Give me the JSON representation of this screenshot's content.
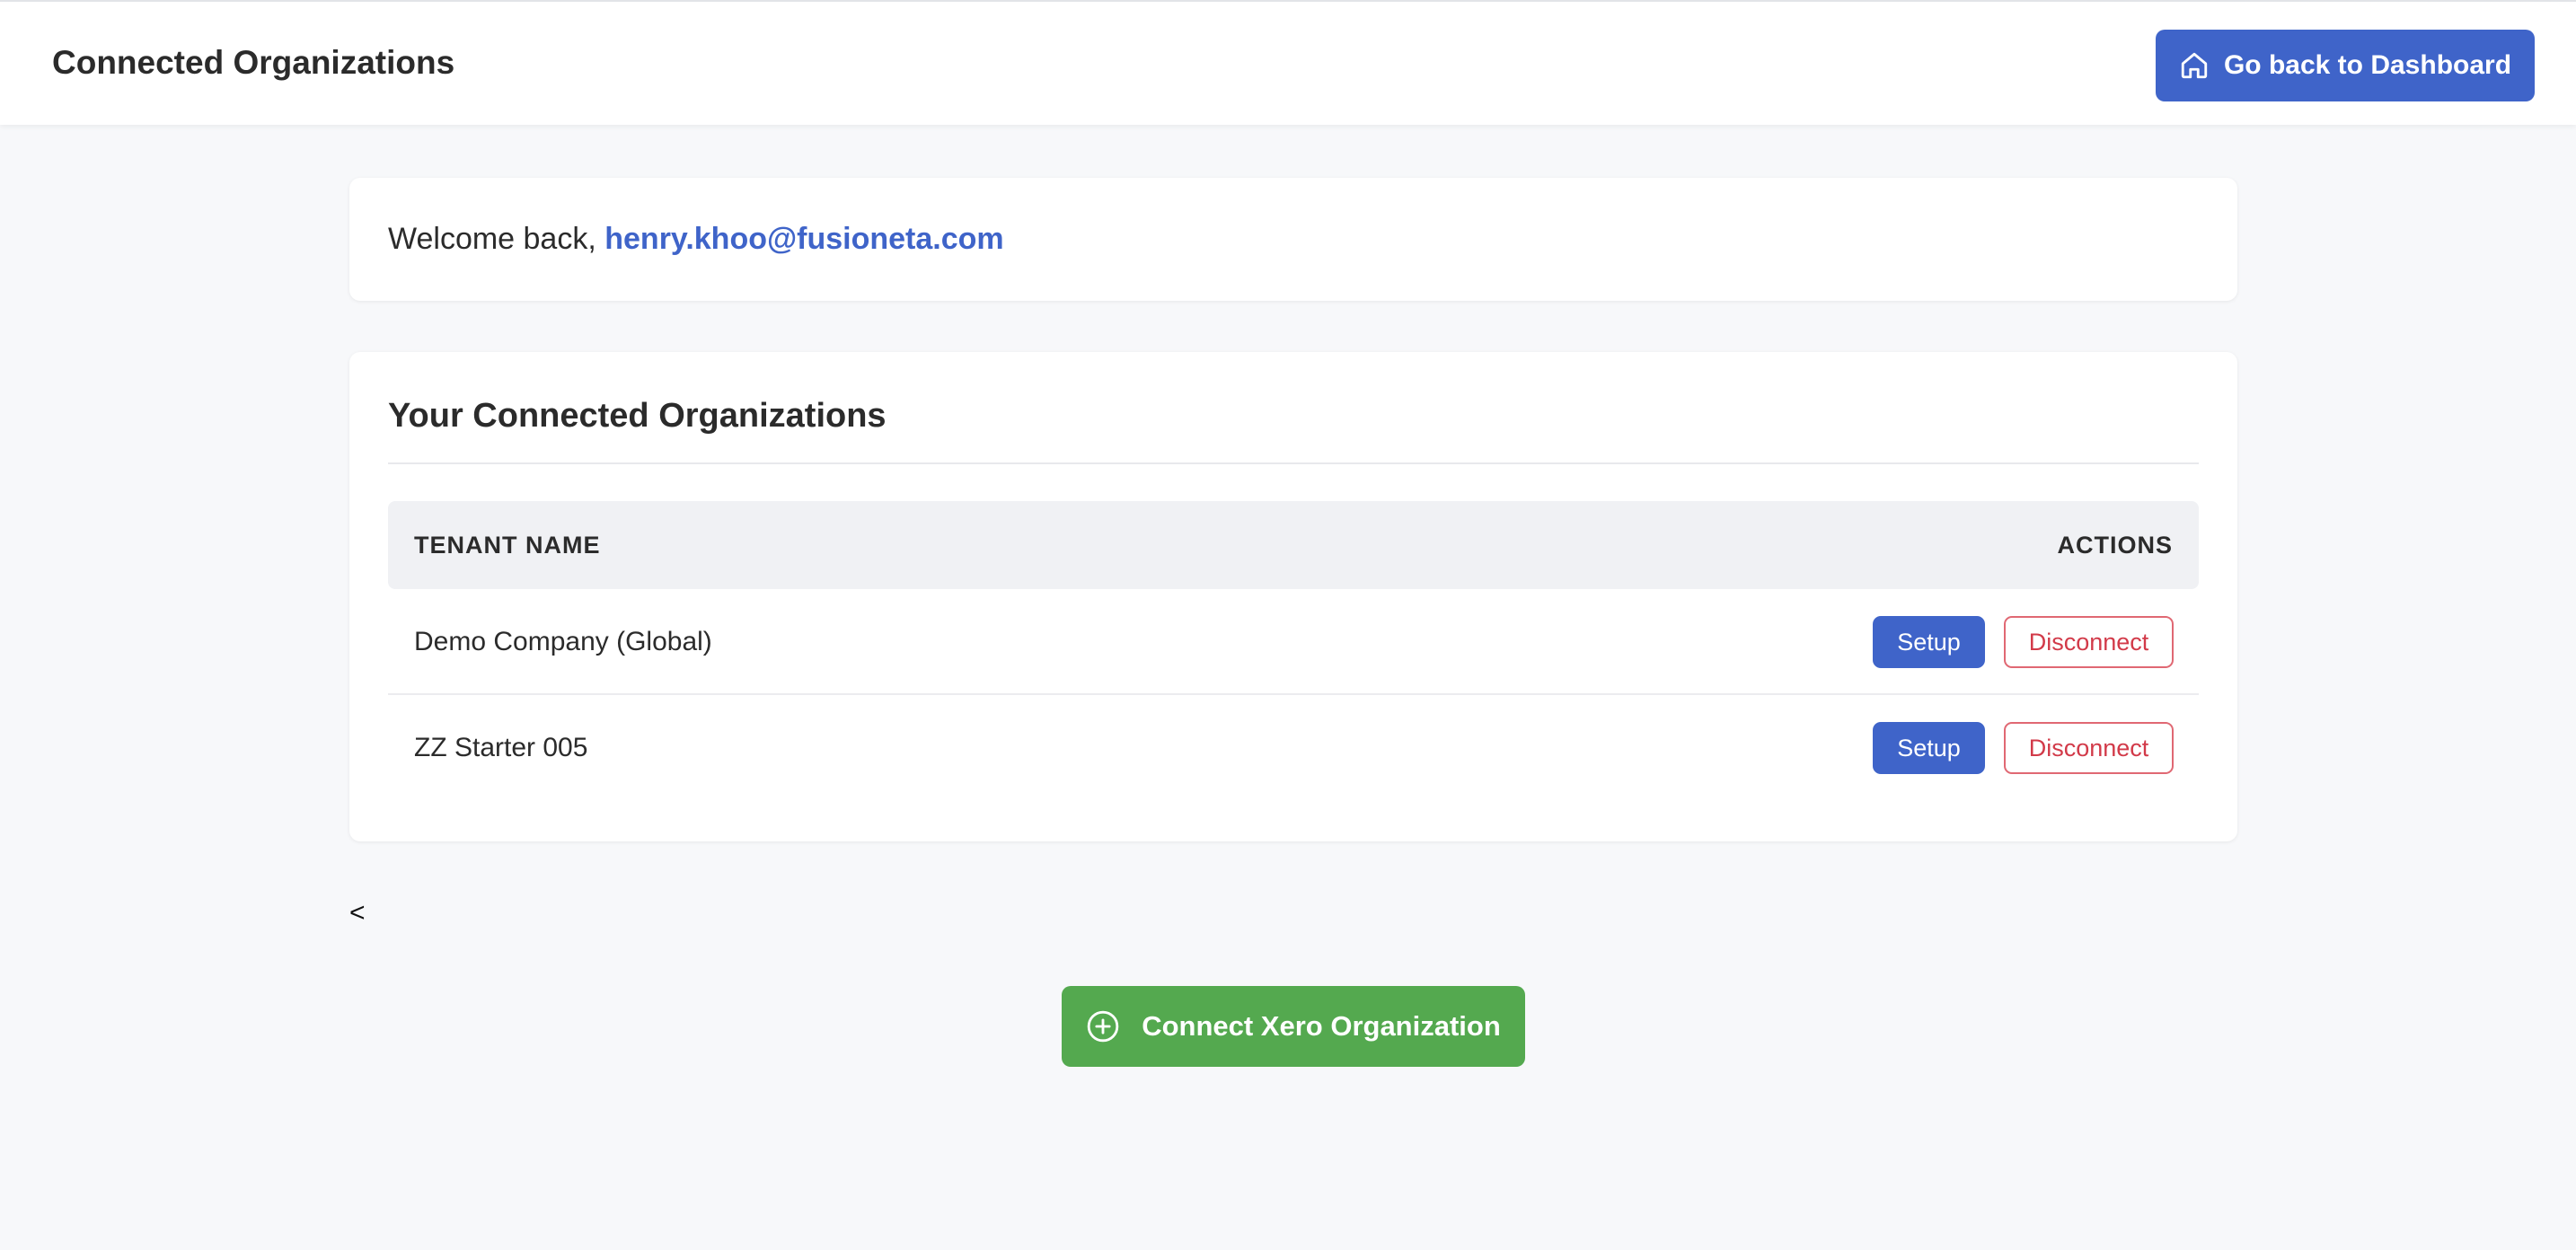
{
  "header": {
    "title": "Connected Organizations",
    "dashboard_button_label": "Go back to Dashboard",
    "dashboard_button_icon": "home-icon"
  },
  "welcome": {
    "prefix": "Welcome back, ",
    "email": "henry.khoo@fusioneta.com"
  },
  "organizations": {
    "section_title": "Your Connected Organizations",
    "columns": [
      "TENANT NAME",
      "ACTIONS"
    ],
    "rows": [
      {
        "tenant_name": "Demo Company (Global)",
        "setup_label": "Setup",
        "disconnect_label": "Disconnect"
      },
      {
        "tenant_name": "ZZ Starter 005",
        "setup_label": "Setup",
        "disconnect_label": "Disconnect"
      }
    ]
  },
  "back_link": "<",
  "connect_button": {
    "label": "Connect Xero Organization",
    "icon": "plus-circle-icon"
  },
  "colors": {
    "primary": "#3f64c9",
    "success": "#54a94f",
    "danger": "#d23a49",
    "background": "#f7f8fa"
  }
}
